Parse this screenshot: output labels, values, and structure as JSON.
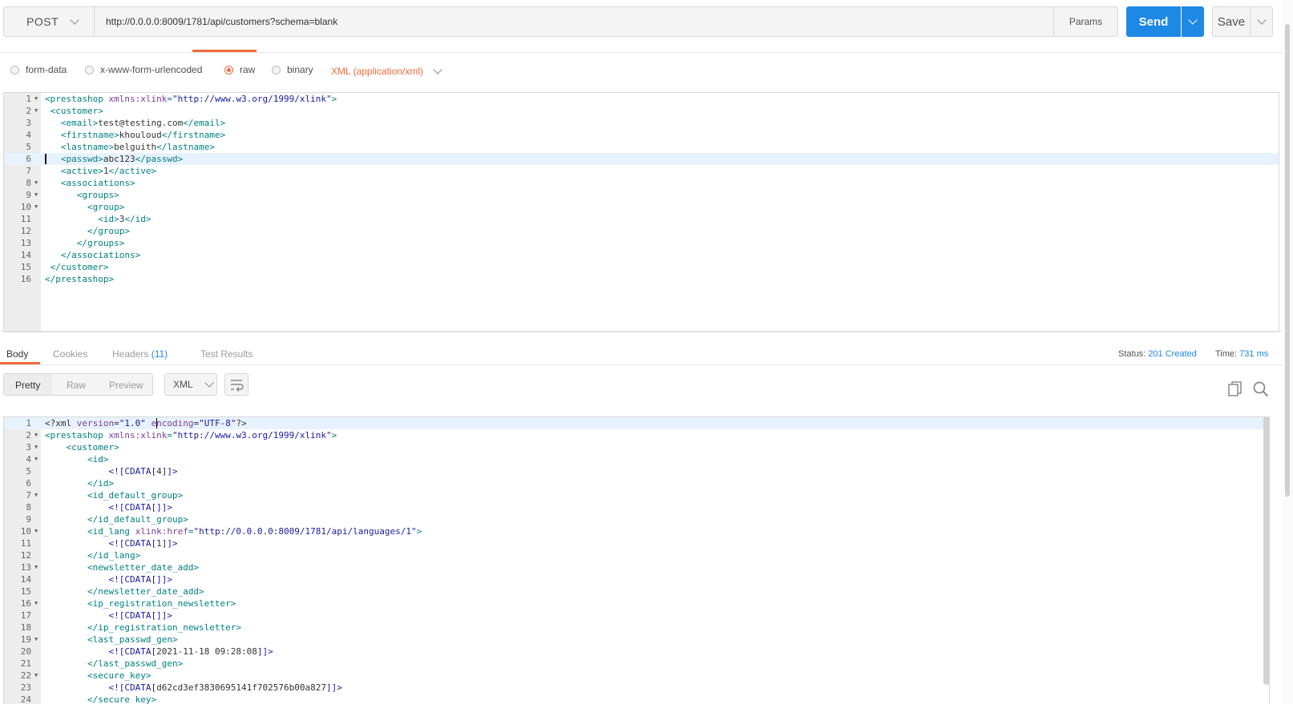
{
  "request": {
    "method": "POST",
    "url": "http://0.0.0.0:8009/1781/api/customers?schema=blank",
    "params_label": "Params",
    "send_label": "Send",
    "save_label": "Save"
  },
  "body_options": {
    "form_data": "form-data",
    "urlencoded": "x-www-form-urlencoded",
    "raw": "raw",
    "binary": "binary",
    "content_type": "XML (application/xml)"
  },
  "request_lines": [
    {
      "n": "1",
      "fold": true,
      "parts": [
        [
          "t",
          "<prestashop "
        ],
        [
          "a",
          "xmlns:xlink"
        ],
        [
          "t",
          "="
        ],
        [
          "s",
          "\"http://www.w3.org/1999/xlink\""
        ],
        [
          "t",
          ">"
        ]
      ]
    },
    {
      "n": "2",
      "fold": true,
      "parts": [
        [
          "x",
          " "
        ],
        [
          "t",
          "<customer>"
        ]
      ]
    },
    {
      "n": "3",
      "fold": false,
      "parts": [
        [
          "x",
          "   "
        ],
        [
          "t",
          "<email>"
        ],
        [
          "x",
          "test@testing.com"
        ],
        [
          "t",
          "</email>"
        ]
      ]
    },
    {
      "n": "4",
      "fold": false,
      "parts": [
        [
          "x",
          "   "
        ],
        [
          "t",
          "<firstname>"
        ],
        [
          "x",
          "khouloud"
        ],
        [
          "t",
          "</firstname>"
        ]
      ]
    },
    {
      "n": "5",
      "fold": false,
      "parts": [
        [
          "x",
          "   "
        ],
        [
          "t",
          "<lastname>"
        ],
        [
          "x",
          "belguith"
        ],
        [
          "t",
          "</lastname>"
        ]
      ]
    },
    {
      "n": "6",
      "fold": false,
      "active": true,
      "parts": [
        [
          "x",
          "   "
        ],
        [
          "t",
          "<passwd>"
        ],
        [
          "x",
          "abc123"
        ],
        [
          "t",
          "</passwd>"
        ]
      ]
    },
    {
      "n": "7",
      "fold": false,
      "parts": [
        [
          "x",
          "   "
        ],
        [
          "t",
          "<active>"
        ],
        [
          "x",
          "1"
        ],
        [
          "t",
          "</active>"
        ]
      ]
    },
    {
      "n": "8",
      "fold": true,
      "parts": [
        [
          "x",
          "   "
        ],
        [
          "t",
          "<associations>"
        ]
      ]
    },
    {
      "n": "9",
      "fold": true,
      "parts": [
        [
          "x",
          "      "
        ],
        [
          "t",
          "<groups>"
        ]
      ]
    },
    {
      "n": "10",
      "fold": true,
      "parts": [
        [
          "x",
          "        "
        ],
        [
          "t",
          "<group>"
        ]
      ]
    },
    {
      "n": "11",
      "fold": false,
      "parts": [
        [
          "x",
          "          "
        ],
        [
          "t",
          "<id>"
        ],
        [
          "x",
          "3"
        ],
        [
          "t",
          "</id>"
        ]
      ]
    },
    {
      "n": "12",
      "fold": false,
      "parts": [
        [
          "x",
          "        "
        ],
        [
          "t",
          "</group>"
        ]
      ]
    },
    {
      "n": "13",
      "fold": false,
      "parts": [
        [
          "x",
          "      "
        ],
        [
          "t",
          "</groups>"
        ]
      ]
    },
    {
      "n": "14",
      "fold": false,
      "parts": [
        [
          "x",
          "   "
        ],
        [
          "t",
          "</associations>"
        ]
      ]
    },
    {
      "n": "15",
      "fold": false,
      "parts": [
        [
          "x",
          " "
        ],
        [
          "t",
          "</customer>"
        ]
      ]
    },
    {
      "n": "16",
      "fold": false,
      "parts": [
        [
          "t",
          "</prestashop>"
        ]
      ]
    }
  ],
  "response_tabs": {
    "body": "Body",
    "cookies": "Cookies",
    "headers": "Headers",
    "headers_count": "(11)",
    "tests": "Test Results"
  },
  "status": {
    "status_label": "Status:",
    "status_value": "201 Created",
    "time_label": "Time:",
    "time_value": "731 ms"
  },
  "view_modes": {
    "pretty": "Pretty",
    "raw": "Raw",
    "preview": "Preview",
    "format": "XML"
  },
  "response_lines": [
    {
      "n": "1",
      "fold": false,
      "active": true,
      "parts": [
        [
          "x",
          "<?xml "
        ],
        [
          "a",
          "version"
        ],
        [
          "x",
          "="
        ],
        [
          "s",
          "\"1.0\""
        ],
        [
          "x",
          " "
        ],
        [
          "a",
          "encoding"
        ],
        [
          "x",
          "="
        ],
        [
          "s",
          "\"UTF-8\""
        ],
        [
          "x",
          "?>"
        ]
      ]
    },
    {
      "n": "2",
      "fold": true,
      "parts": [
        [
          "t",
          "<prestashop "
        ],
        [
          "a",
          "xmlns:xlink"
        ],
        [
          "t",
          "="
        ],
        [
          "s",
          "\"http://www.w3.org/1999/xlink\""
        ],
        [
          "t",
          ">"
        ]
      ]
    },
    {
      "n": "3",
      "fold": true,
      "parts": [
        [
          "x",
          "    "
        ],
        [
          "t",
          "<customer>"
        ]
      ]
    },
    {
      "n": "4",
      "fold": true,
      "parts": [
        [
          "x",
          "        "
        ],
        [
          "t",
          "<id>"
        ]
      ]
    },
    {
      "n": "5",
      "fold": false,
      "parts": [
        [
          "x",
          "            "
        ],
        [
          "c",
          "<![CDATA["
        ],
        [
          "x",
          "4"
        ],
        [
          "c",
          "]]>"
        ]
      ]
    },
    {
      "n": "6",
      "fold": false,
      "parts": [
        [
          "x",
          "        "
        ],
        [
          "t",
          "</id>"
        ]
      ]
    },
    {
      "n": "7",
      "fold": true,
      "parts": [
        [
          "x",
          "        "
        ],
        [
          "t",
          "<id_default_group>"
        ]
      ]
    },
    {
      "n": "8",
      "fold": false,
      "parts": [
        [
          "x",
          "            "
        ],
        [
          "c",
          "<![CDATA[]]>"
        ]
      ]
    },
    {
      "n": "9",
      "fold": false,
      "parts": [
        [
          "x",
          "        "
        ],
        [
          "t",
          "</id_default_group>"
        ]
      ]
    },
    {
      "n": "10",
      "fold": true,
      "parts": [
        [
          "x",
          "        "
        ],
        [
          "t",
          "<id_lang "
        ],
        [
          "a",
          "xlink:href"
        ],
        [
          "t",
          "="
        ],
        [
          "s",
          "\"http://0.0.0.0:8009/1781/api/languages/1\""
        ],
        [
          "t",
          ">"
        ]
      ]
    },
    {
      "n": "11",
      "fold": false,
      "parts": [
        [
          "x",
          "            "
        ],
        [
          "c",
          "<![CDATA["
        ],
        [
          "x",
          "1"
        ],
        [
          "c",
          "]]>"
        ]
      ]
    },
    {
      "n": "12",
      "fold": false,
      "parts": [
        [
          "x",
          "        "
        ],
        [
          "t",
          "</id_lang>"
        ]
      ]
    },
    {
      "n": "13",
      "fold": true,
      "parts": [
        [
          "x",
          "        "
        ],
        [
          "t",
          "<newsletter_date_add>"
        ]
      ]
    },
    {
      "n": "14",
      "fold": false,
      "parts": [
        [
          "x",
          "            "
        ],
        [
          "c",
          "<![CDATA[]]>"
        ]
      ]
    },
    {
      "n": "15",
      "fold": false,
      "parts": [
        [
          "x",
          "        "
        ],
        [
          "t",
          "</newsletter_date_add>"
        ]
      ]
    },
    {
      "n": "16",
      "fold": true,
      "parts": [
        [
          "x",
          "        "
        ],
        [
          "t",
          "<ip_registration_newsletter>"
        ]
      ]
    },
    {
      "n": "17",
      "fold": false,
      "parts": [
        [
          "x",
          "            "
        ],
        [
          "c",
          "<![CDATA[]]>"
        ]
      ]
    },
    {
      "n": "18",
      "fold": false,
      "parts": [
        [
          "x",
          "        "
        ],
        [
          "t",
          "</ip_registration_newsletter>"
        ]
      ]
    },
    {
      "n": "19",
      "fold": true,
      "parts": [
        [
          "x",
          "        "
        ],
        [
          "t",
          "<last_passwd_gen>"
        ]
      ]
    },
    {
      "n": "20",
      "fold": false,
      "parts": [
        [
          "x",
          "            "
        ],
        [
          "c",
          "<![CDATA["
        ],
        [
          "x",
          "2021-11-18 09:28:08"
        ],
        [
          "c",
          "]]>"
        ]
      ]
    },
    {
      "n": "21",
      "fold": false,
      "parts": [
        [
          "x",
          "        "
        ],
        [
          "t",
          "</last_passwd_gen>"
        ]
      ]
    },
    {
      "n": "22",
      "fold": true,
      "parts": [
        [
          "x",
          "        "
        ],
        [
          "t",
          "<secure_key>"
        ]
      ]
    },
    {
      "n": "23",
      "fold": false,
      "parts": [
        [
          "x",
          "            "
        ],
        [
          "c",
          "<![CDATA["
        ],
        [
          "x",
          "d62cd3ef3830695141f702576b00a827"
        ],
        [
          "c",
          "]]>"
        ]
      ]
    },
    {
      "n": "24",
      "fold": false,
      "parts": [
        [
          "x",
          "        "
        ],
        [
          "t",
          "</secure_key>"
        ]
      ]
    }
  ]
}
